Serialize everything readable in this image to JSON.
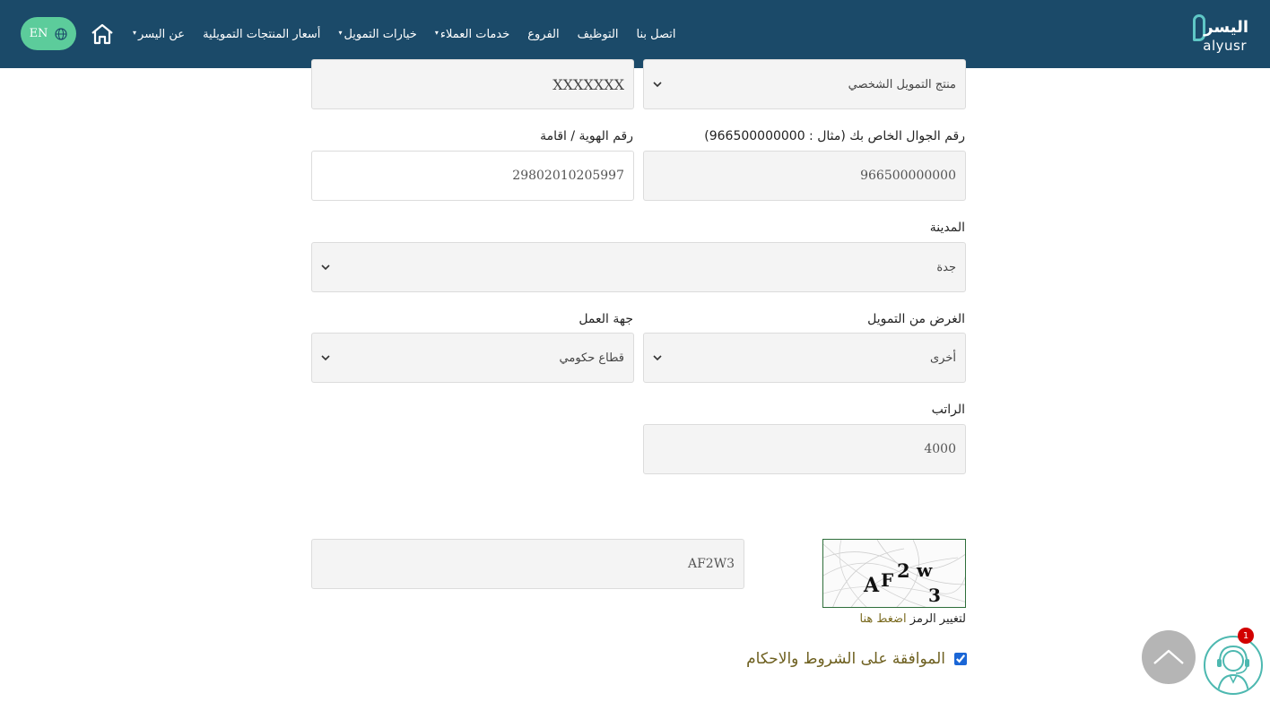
{
  "header": {
    "logo_ar": "اليسر",
    "logo_en": "alyusr",
    "nav": [
      {
        "label": "عن اليسر",
        "dropdown": true
      },
      {
        "label": "أسعار المنتجات التمويلية",
        "dropdown": false
      },
      {
        "label": "خيارات التمويل",
        "dropdown": true
      },
      {
        "label": "خدمات العملاء",
        "dropdown": true
      },
      {
        "label": "الفروع",
        "dropdown": false
      },
      {
        "label": "التوظيف",
        "dropdown": false
      },
      {
        "label": "اتصل بنا",
        "dropdown": false
      }
    ],
    "lang_label": "EN",
    "home_icon": "home-icon",
    "globe_icon": "globe-icon"
  },
  "form": {
    "product": {
      "value": "منتج التمويل الشخصي"
    },
    "name": {
      "value": "XXXXXXX"
    },
    "mobile": {
      "label": "رقم الجوال الخاص بك (مثال : 966500000000)",
      "value": "966500000000"
    },
    "id_number": {
      "label": "رقم الهوية / اقامة",
      "value": "29802010205997"
    },
    "city": {
      "label": "المدينة",
      "value": "جدة"
    },
    "purpose": {
      "label": "الغرض من التمويل",
      "value": "أخرى"
    },
    "employer": {
      "label": "جهة العمل",
      "value": "قطاع حكومي"
    },
    "salary": {
      "label": "الراتب",
      "value": "4000"
    },
    "captcha": {
      "chars": [
        "A",
        "F",
        "2",
        "w",
        "3"
      ],
      "input_value": "AF2W3",
      "refresh_text": "لتغيير الرمز",
      "refresh_link": "اضغط هنا"
    },
    "terms": {
      "label": "الموافقة على الشروط والاحكام",
      "checked": true
    }
  },
  "widgets": {
    "scroll_top_icon": "chevron-up-icon",
    "chat_icon": "support-agent-icon",
    "chat_badge": "1"
  },
  "colors": {
    "header_bg": "#1b4a69",
    "lang_btn": "#5ccc9b",
    "link": "#7a6a1f",
    "badge": "#d20000"
  }
}
